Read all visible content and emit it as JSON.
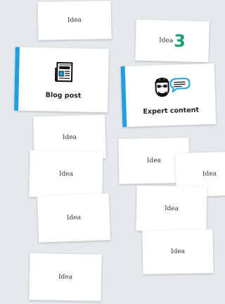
{
  "cards": {
    "idea_label": "Idea",
    "count_badge": "3",
    "count_badge_color": "#1f9b78",
    "accent_color": "#1e9fe0"
  },
  "featured": [
    {
      "label": "Blog post",
      "icon": "newspaper-icon"
    },
    {
      "label": "Expert content",
      "icon": "expert-speech-icon"
    }
  ]
}
